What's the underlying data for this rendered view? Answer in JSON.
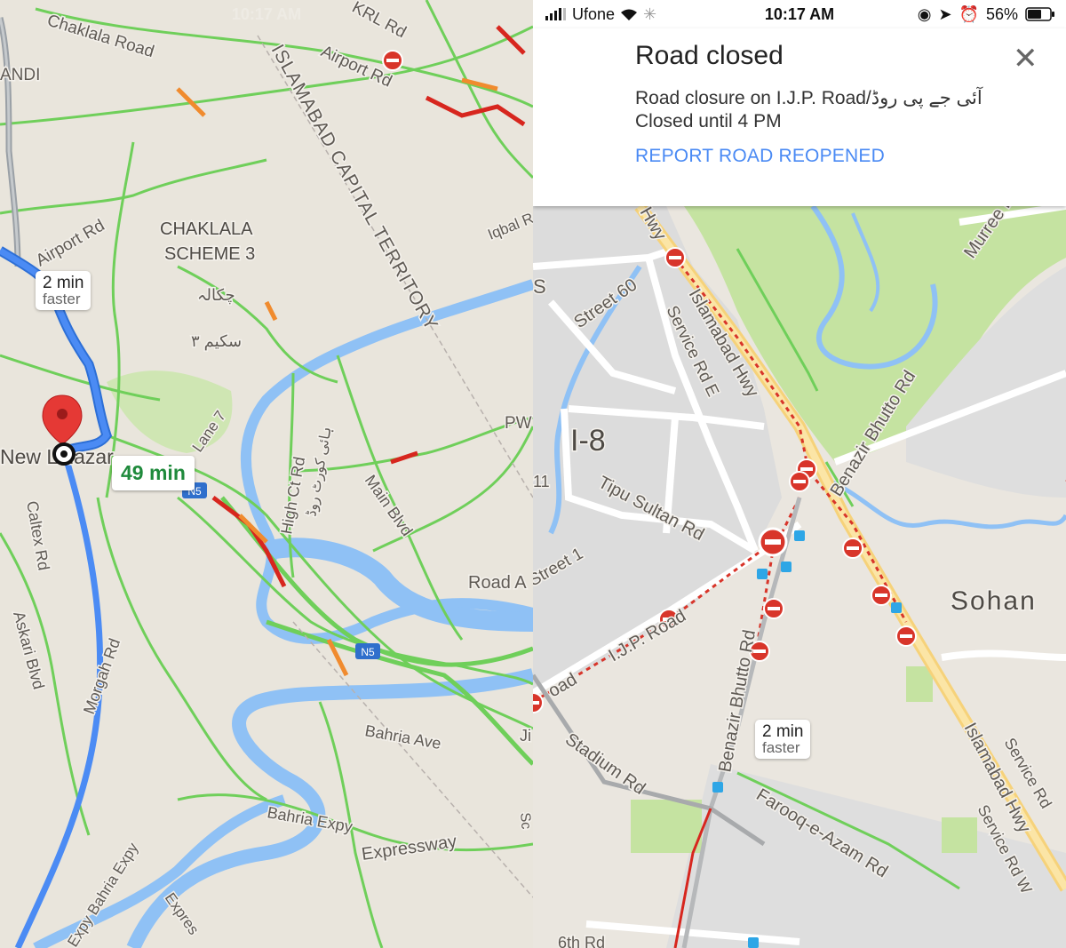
{
  "left": {
    "status_time": "10:17 AM",
    "labels": {
      "chaklala_road": "Chaklala Road",
      "airport_rd_top": "Airport Rd",
      "krl_rd": "KRL Rd",
      "andi": "ANDI",
      "islamabad_capital_territory": "ISLAMABAD CAPITAL TERRITORY",
      "airport_rd_left": "Airport Rd",
      "chaklala_scheme_line1": "CHAKLALA",
      "chaklala_scheme_line2": "SCHEME 3",
      "urdu_chaklala": "چکالہ",
      "urdu_scheme": "سکیم ۳",
      "iqbal": "Iqbal R",
      "lane7": "Lane 7",
      "high_ct_rd": "High Ct Rd",
      "urdu_high_ct": "ہائی کورٹ روڈ",
      "main_blvd": "Main Blvd",
      "pw": "PW",
      "road_a": "Road A",
      "new_lalazar": "New Lalazar",
      "caltex_rd": "Caltex Rd",
      "askari_blvd": "Askari Blvd",
      "morgah_rd": "Morgah Rd",
      "bahria_ave": "Bahria Ave",
      "bahria_expy": "Bahria Expy",
      "expressway": "Expressway",
      "expy_bahria": "Expy Bahria Expy",
      "express": "Expres",
      "ji": "Ji",
      "sc": "Sc",
      "n5_a": "N5",
      "n5_b": "N5"
    },
    "faster_callout": {
      "time": "2 min",
      "note": "faster"
    },
    "eta": "49 min"
  },
  "right": {
    "status": {
      "carrier": "Ufone",
      "time": "10:17 AM",
      "battery": "56%"
    },
    "sheet": {
      "title": "Road closed",
      "description": "Road closure on I.J.P. Road/آئی جے پی روڈ",
      "until": "Closed until 4 PM",
      "action": "REPORT ROAD REOPENED"
    },
    "labels": {
      "murree": "Murree R",
      "s": "S",
      "street60": "Street 60",
      "hwy": "Hwy",
      "service_rd_e": "Service Rd E",
      "islamabad_hwy_1": "Islamabad Hwy",
      "benazir_bhutto_rd_1": "Benazir Bhutto Rd",
      "i8": "I-8",
      "tipu_sultan_rd": "Tipu Sultan Rd",
      "eleven": "11",
      "street1": "Street 1",
      "ijp_road": "I.J.P. Road",
      "oad": "oad",
      "sohan": "Sohan",
      "benazir_bhutto_rd_2": "Benazir Bhutto Rd",
      "stadium_rd": "Stadium Rd",
      "farooq_e_azam_rd": "Farooq-e-Azam Rd",
      "islamabad_hwy_2": "Islamabad Hwy",
      "service_rd_1": "Service Rd",
      "service_rd_w": "Service Rd W",
      "sixth_rd": "6th Rd"
    },
    "faster_callout": {
      "time": "2 min",
      "note": "faster"
    }
  },
  "colors": {
    "traffic_green": "#6fcf5a",
    "traffic_orange": "#f08b2e",
    "traffic_red": "#d7261e",
    "route_blue": "#4b8bf4",
    "water": "#8fc1f5",
    "park": "#c5e3a1",
    "closure_red": "#d8352a",
    "link_blue": "#4a8af4"
  }
}
